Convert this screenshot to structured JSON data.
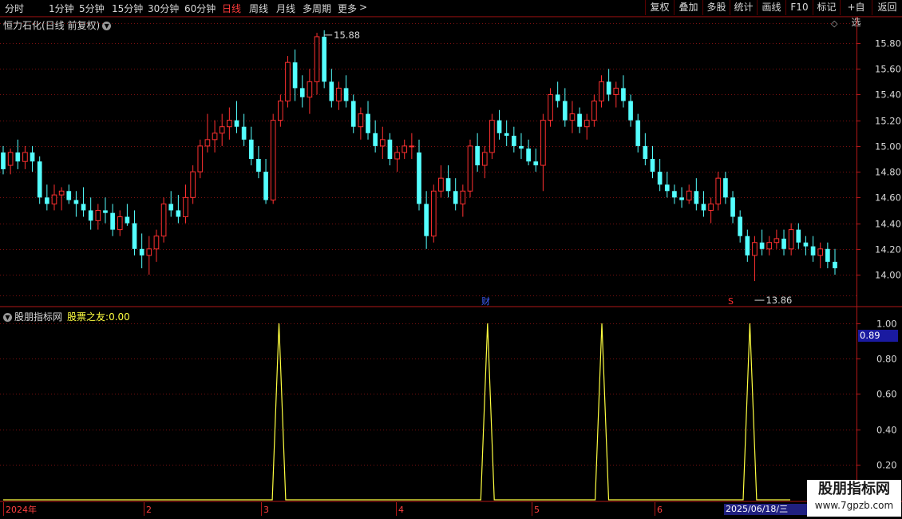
{
  "toolbar": {
    "periods": [
      "分时",
      "1分钟",
      "5分钟",
      "15分钟",
      "30分钟",
      "60分钟",
      "日线",
      "周线",
      "月线",
      "多周期",
      "更多"
    ],
    "active_period": "日线",
    "more_arrow": ">",
    "buttons": [
      "复权",
      "叠加",
      "多股",
      "统计",
      "画线",
      "F10",
      "标记",
      "+自选",
      "返回"
    ]
  },
  "stock": {
    "title": "恒力石化(日线 前复权)"
  },
  "price_axis": {
    "labels": [
      "15.80",
      "15.60",
      "15.40",
      "15.20",
      "15.00",
      "14.80",
      "14.60",
      "14.40",
      "14.20",
      "14.00"
    ],
    "high_marker": "15.88",
    "low_marker": "13.86",
    "event_cai": "财",
    "event_s": "S"
  },
  "indicator": {
    "name": "股朋指标网",
    "value_name": "股票之友:",
    "value": "0.00",
    "axis_labels": [
      "1.00",
      "0.80",
      "0.60",
      "0.40",
      "0.20"
    ],
    "cursor_value": "0.89"
  },
  "date_axis": {
    "labels": [
      "2024年",
      "2",
      "3",
      "4",
      "5",
      "6"
    ],
    "current_date": "2025/06/18/三"
  },
  "watermark": {
    "line1": "股朋指标网",
    "line2": "www.7gpzb.com"
  },
  "colors": {
    "up": "#ff3030",
    "down": "#54ffff",
    "indicator_line": "#ffff40",
    "grid": "#7a1010"
  },
  "chart_data": {
    "type": "candlestick",
    "price_range": [
      13.86,
      15.88
    ],
    "candles_ohlc": [
      [
        14.95,
        15.0,
        14.78,
        14.82
      ],
      [
        14.85,
        14.98,
        14.78,
        14.95
      ],
      [
        14.95,
        15.05,
        14.82,
        14.88
      ],
      [
        14.88,
        15.0,
        14.82,
        14.95
      ],
      [
        14.95,
        15.0,
        14.8,
        14.88
      ],
      [
        14.88,
        14.92,
        14.55,
        14.6
      ],
      [
        14.6,
        14.7,
        14.5,
        14.55
      ],
      [
        14.55,
        14.7,
        14.5,
        14.62
      ],
      [
        14.62,
        14.68,
        14.5,
        14.65
      ],
      [
        14.65,
        14.7,
        14.55,
        14.58
      ],
      [
        14.58,
        14.65,
        14.45,
        14.55
      ],
      [
        14.55,
        14.68,
        14.45,
        14.5
      ],
      [
        14.5,
        14.6,
        14.35,
        14.42
      ],
      [
        14.42,
        14.55,
        14.35,
        14.5
      ],
      [
        14.5,
        14.6,
        14.4,
        14.48
      ],
      [
        14.48,
        14.55,
        14.3,
        14.35
      ],
      [
        14.35,
        14.5,
        14.3,
        14.45
      ],
      [
        14.45,
        14.55,
        14.38,
        14.4
      ],
      [
        14.4,
        14.5,
        14.15,
        14.2
      ],
      [
        14.2,
        14.32,
        14.05,
        14.15
      ],
      [
        14.15,
        14.3,
        14.0,
        14.2
      ],
      [
        14.2,
        14.35,
        14.1,
        14.3
      ],
      [
        14.3,
        14.6,
        14.25,
        14.55
      ],
      [
        14.55,
        14.65,
        14.45,
        14.5
      ],
      [
        14.5,
        14.62,
        14.4,
        14.45
      ],
      [
        14.45,
        14.7,
        14.4,
        14.6
      ],
      [
        14.6,
        14.85,
        14.55,
        14.8
      ],
      [
        14.8,
        15.05,
        14.75,
        15.0
      ],
      [
        15.0,
        15.25,
        14.95,
        15.05
      ],
      [
        15.05,
        15.2,
        14.95,
        15.1
      ],
      [
        15.1,
        15.25,
        15.0,
        15.15
      ],
      [
        15.15,
        15.3,
        15.05,
        15.2
      ],
      [
        15.2,
        15.35,
        15.1,
        15.15
      ],
      [
        15.15,
        15.25,
        15.0,
        15.05
      ],
      [
        15.05,
        15.15,
        14.85,
        14.9
      ],
      [
        14.9,
        15.0,
        14.75,
        14.8
      ],
      [
        14.8,
        14.9,
        14.55,
        14.58
      ],
      [
        14.58,
        15.25,
        14.55,
        15.2
      ],
      [
        15.2,
        15.4,
        15.15,
        15.35
      ],
      [
        15.35,
        15.7,
        15.3,
        15.65
      ],
      [
        15.65,
        15.75,
        15.35,
        15.45
      ],
      [
        15.45,
        15.55,
        15.3,
        15.38
      ],
      [
        15.38,
        15.6,
        15.25,
        15.5
      ],
      [
        15.5,
        15.88,
        15.4,
        15.85
      ],
      [
        15.85,
        15.9,
        15.45,
        15.5
      ],
      [
        15.5,
        15.6,
        15.3,
        15.35
      ],
      [
        15.35,
        15.5,
        15.28,
        15.45
      ],
      [
        15.45,
        15.55,
        15.3,
        15.35
      ],
      [
        15.35,
        15.4,
        15.1,
        15.15
      ],
      [
        15.15,
        15.3,
        15.05,
        15.25
      ],
      [
        15.25,
        15.35,
        15.05,
        15.1
      ],
      [
        15.1,
        15.2,
        14.95,
        15.0
      ],
      [
        15.0,
        15.15,
        14.9,
        15.05
      ],
      [
        15.05,
        15.1,
        14.85,
        14.9
      ],
      [
        14.9,
        15.0,
        14.8,
        14.95
      ],
      [
        14.95,
        15.05,
        14.9,
        15.0
      ],
      [
        15.0,
        15.1,
        14.9,
        15.0
      ],
      [
        14.95,
        15.05,
        14.5,
        14.55
      ],
      [
        14.55,
        14.65,
        14.2,
        14.3
      ],
      [
        14.3,
        14.7,
        14.25,
        14.65
      ],
      [
        14.65,
        14.85,
        14.6,
        14.75
      ],
      [
        14.75,
        14.85,
        14.6,
        14.65
      ],
      [
        14.65,
        14.75,
        14.5,
        14.55
      ],
      [
        14.55,
        14.7,
        14.45,
        14.65
      ],
      [
        14.65,
        15.05,
        14.6,
        15.0
      ],
      [
        15.0,
        15.1,
        14.8,
        14.85
      ],
      [
        14.85,
        15.0,
        14.75,
        14.95
      ],
      [
        14.95,
        15.25,
        14.9,
        15.2
      ],
      [
        15.2,
        15.28,
        15.05,
        15.1
      ],
      [
        15.1,
        15.2,
        15.0,
        15.08
      ],
      [
        15.08,
        15.15,
        14.95,
        15.0
      ],
      [
        15.0,
        15.1,
        14.9,
        14.98
      ],
      [
        14.98,
        15.05,
        14.85,
        14.88
      ],
      [
        14.88,
        14.98,
        14.8,
        14.85
      ],
      [
        14.85,
        15.25,
        14.65,
        15.2
      ],
      [
        15.2,
        15.45,
        15.15,
        15.4
      ],
      [
        15.4,
        15.5,
        15.3,
        15.35
      ],
      [
        15.35,
        15.45,
        15.15,
        15.2
      ],
      [
        15.2,
        15.35,
        15.1,
        15.25
      ],
      [
        15.25,
        15.3,
        15.1,
        15.15
      ],
      [
        15.15,
        15.25,
        15.05,
        15.2
      ],
      [
        15.2,
        15.4,
        15.15,
        15.35
      ],
      [
        15.35,
        15.55,
        15.3,
        15.5
      ],
      [
        15.5,
        15.6,
        15.35,
        15.4
      ],
      [
        15.4,
        15.5,
        15.3,
        15.45
      ],
      [
        15.45,
        15.55,
        15.3,
        15.35
      ],
      [
        15.35,
        15.4,
        15.15,
        15.2
      ],
      [
        15.2,
        15.25,
        14.95,
        15.0
      ],
      [
        15.0,
        15.1,
        14.85,
        14.9
      ],
      [
        14.9,
        15.0,
        14.75,
        14.8
      ],
      [
        14.8,
        14.9,
        14.65,
        14.7
      ],
      [
        14.7,
        14.8,
        14.6,
        14.65
      ],
      [
        14.65,
        14.7,
        14.55,
        14.6
      ],
      [
        14.6,
        14.68,
        14.52,
        14.58
      ],
      [
        14.58,
        14.7,
        14.55,
        14.65
      ],
      [
        14.65,
        14.75,
        14.5,
        14.55
      ],
      [
        14.55,
        14.65,
        14.45,
        14.5
      ],
      [
        14.5,
        14.6,
        14.4,
        14.55
      ],
      [
        14.55,
        14.8,
        14.5,
        14.75
      ],
      [
        14.75,
        14.8,
        14.55,
        14.6
      ],
      [
        14.6,
        14.65,
        14.4,
        14.45
      ],
      [
        14.45,
        14.5,
        14.25,
        14.3
      ],
      [
        14.3,
        14.35,
        14.1,
        14.15
      ],
      [
        14.15,
        14.3,
        13.95,
        14.25
      ],
      [
        14.25,
        14.35,
        14.15,
        14.2
      ],
      [
        14.2,
        14.3,
        14.15,
        14.25
      ],
      [
        14.25,
        14.35,
        14.2,
        14.28
      ],
      [
        14.28,
        14.35,
        14.15,
        14.2
      ],
      [
        14.2,
        14.4,
        14.15,
        14.35
      ],
      [
        14.35,
        14.4,
        14.2,
        14.25
      ],
      [
        14.25,
        14.3,
        14.15,
        14.22
      ],
      [
        14.22,
        14.3,
        14.1,
        14.15
      ],
      [
        14.15,
        14.25,
        14.05,
        14.2
      ],
      [
        14.2,
        14.25,
        14.05,
        14.1
      ],
      [
        14.1,
        14.2,
        14.0,
        14.05
      ]
    ],
    "signal_values": [
      0,
      0,
      0,
      0,
      0,
      0,
      0,
      0,
      0,
      0,
      0,
      0,
      0,
      0,
      0,
      0,
      0,
      0,
      0,
      0,
      0,
      0,
      0,
      0,
      0,
      0,
      0,
      0,
      0,
      0,
      0,
      0,
      0,
      0,
      0,
      0,
      0,
      0,
      0,
      0,
      0,
      1,
      0,
      0,
      0,
      0,
      0,
      0,
      0,
      0,
      0,
      0,
      0,
      0,
      0,
      0,
      0,
      0,
      0,
      0,
      0,
      0,
      0,
      0,
      0,
      0,
      0,
      0,
      0,
      0,
      0,
      0,
      1,
      0,
      0,
      0,
      0,
      0,
      0,
      0,
      0,
      0,
      0,
      0,
      0,
      0,
      0,
      0,
      0,
      1,
      0,
      0,
      0,
      0,
      0,
      0,
      0,
      0,
      0,
      0,
      0,
      0,
      0,
      0,
      0,
      0,
      0,
      0,
      0,
      0,
      0,
      1,
      0,
      0,
      0,
      0,
      0,
      0
    ],
    "signal_range": [
      0,
      1
    ]
  }
}
